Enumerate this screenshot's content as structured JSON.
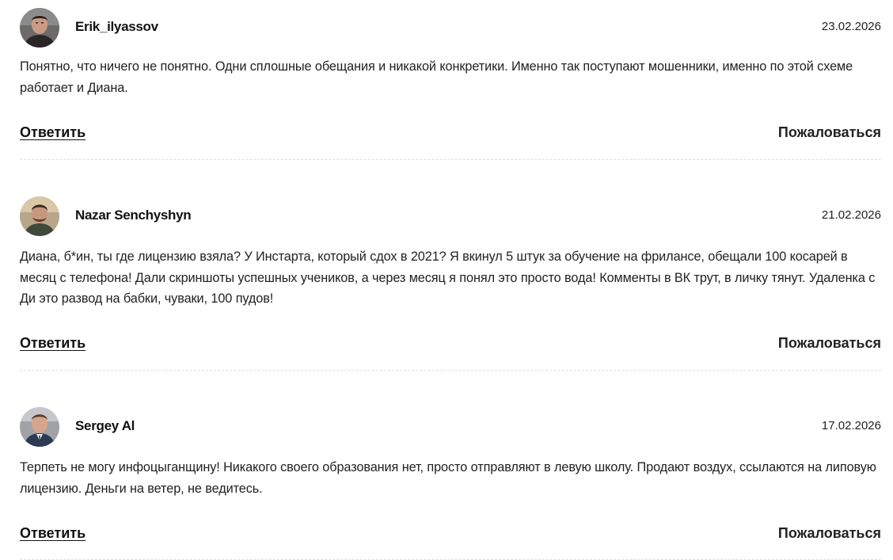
{
  "comments": [
    {
      "author": "Erik_ilyassov",
      "date": "23.02.2026",
      "text": "Понятно, что ничего не понятно. Одни сплошные обещания и никакой конкретики. Именно так поступают мошенники, именно по этой схеме работает и Диана.",
      "reply_label": "Ответить",
      "report_label": "Пожаловаться",
      "avatar": "user-photo-icon"
    },
    {
      "author": "Nazar Senchyshyn",
      "date": "21.02.2026",
      "text": "Диана, б*ин, ты где лицензию взяла? У Инстарта, который сдох в 2021? Я вкинул 5 штук за обучение на фрилансе, обещали 100 косарей в месяц с телефона! Дали скриншоты успешных учеников, а через месяц я понял это просто вода! Комменты в ВК трут, в личку тянут. Удаленка с Ди это развод на бабки, чуваки, 100 пудов!",
      "reply_label": "Ответить",
      "report_label": "Пожаловаться",
      "avatar": "user-photo-icon"
    },
    {
      "author": "Sergey Al",
      "date": "17.02.2026",
      "text": "Терпеть не могу инфоцыганщину! Никакого своего образования нет, просто отправляют в левую школу. Продают воздух, ссылаются на липовую лицензию. Деньги на ветер, не ведитесь.",
      "reply_label": "Ответить",
      "report_label": "Пожаловаться",
      "avatar": "user-photo-icon"
    }
  ],
  "colors": {
    "text": "#222222",
    "divider": "#e2e2e2",
    "background": "#ffffff"
  }
}
